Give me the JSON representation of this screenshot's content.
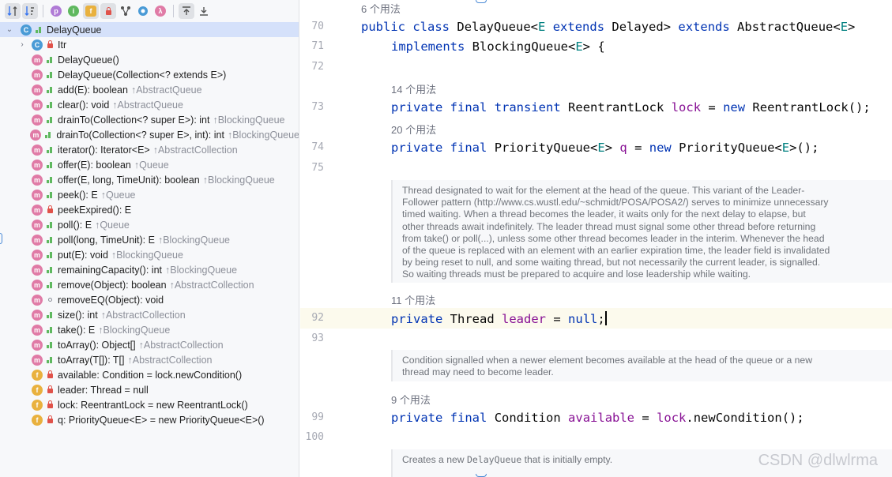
{
  "toolbar": {
    "buttons": [
      {
        "icon": "sort-by-visibility-icon",
        "glyph": "↓⇅"
      },
      {
        "icon": "sort-alphabetically-icon",
        "glyph": "↓a"
      },
      {
        "icon": "show-properties-icon",
        "glyph": "p"
      },
      {
        "icon": "show-inherited-icon",
        "glyph": "i"
      },
      {
        "icon": "show-fields-icon",
        "glyph": "f"
      },
      {
        "icon": "show-non-public-icon",
        "glyph": "🔒"
      },
      {
        "icon": "show-lambdas-icon",
        "glyph": "Y"
      },
      {
        "icon": "show-anonymous-icon",
        "glyph": "◎"
      },
      {
        "icon": "show-lambda-icon",
        "glyph": "λ"
      },
      {
        "icon": "expand-all-icon",
        "glyph": "⤒"
      },
      {
        "icon": "collapse-all-icon",
        "glyph": "⤓"
      }
    ]
  },
  "tree": {
    "root": {
      "kind": "C",
      "name": "DelayQueue"
    },
    "items": [
      {
        "kind": "C",
        "vis": "lock",
        "name": "Itr",
        "inherited": "",
        "expandable": true
      },
      {
        "kind": "m",
        "vis": "pub",
        "name": "DelayQueue()",
        "inherited": ""
      },
      {
        "kind": "m",
        "vis": "pub",
        "name": "DelayQueue(Collection<? extends E>)",
        "inherited": ""
      },
      {
        "kind": "m",
        "vis": "pub",
        "name": "add(E): boolean",
        "inherited": "↑AbstractQueue"
      },
      {
        "kind": "m",
        "vis": "pub",
        "name": "clear(): void",
        "inherited": "↑AbstractQueue"
      },
      {
        "kind": "m",
        "vis": "pub",
        "name": "drainTo(Collection<? super E>): int",
        "inherited": "↑BlockingQueue"
      },
      {
        "kind": "m",
        "vis": "pub",
        "name": "drainTo(Collection<? super E>, int): int",
        "inherited": "↑BlockingQueue"
      },
      {
        "kind": "m",
        "vis": "pub",
        "name": "iterator(): Iterator<E>",
        "inherited": "↑AbstractCollection"
      },
      {
        "kind": "m",
        "vis": "pub",
        "name": "offer(E): boolean",
        "inherited": "↑Queue"
      },
      {
        "kind": "m",
        "vis": "pub",
        "name": "offer(E, long, TimeUnit): boolean",
        "inherited": "↑BlockingQueue"
      },
      {
        "kind": "m",
        "vis": "pub",
        "name": "peek(): E",
        "inherited": "↑Queue"
      },
      {
        "kind": "m",
        "vis": "lock",
        "name": "peekExpired(): E",
        "inherited": ""
      },
      {
        "kind": "m",
        "vis": "pub",
        "name": "poll(): E",
        "inherited": "↑Queue"
      },
      {
        "kind": "m",
        "vis": "pub",
        "name": "poll(long, TimeUnit): E",
        "inherited": "↑BlockingQueue"
      },
      {
        "kind": "m",
        "vis": "pub",
        "name": "put(E): void",
        "inherited": "↑BlockingQueue"
      },
      {
        "kind": "m",
        "vis": "pub",
        "name": "remainingCapacity(): int",
        "inherited": "↑BlockingQueue"
      },
      {
        "kind": "m",
        "vis": "pub",
        "name": "remove(Object): boolean",
        "inherited": "↑AbstractCollection"
      },
      {
        "kind": "m",
        "vis": "pkg",
        "name": "removeEQ(Object): void",
        "inherited": ""
      },
      {
        "kind": "m",
        "vis": "pub",
        "name": "size(): int",
        "inherited": "↑AbstractCollection"
      },
      {
        "kind": "m",
        "vis": "pub",
        "name": "take(): E",
        "inherited": "↑BlockingQueue"
      },
      {
        "kind": "m",
        "vis": "pub",
        "name": "toArray(): Object[]",
        "inherited": "↑AbstractCollection"
      },
      {
        "kind": "m",
        "vis": "pub",
        "name": "toArray(T[]): T[]",
        "inherited": "↑AbstractCollection"
      },
      {
        "kind": "f",
        "vis": "lock",
        "final": true,
        "name": "available: Condition = lock.newCondition()",
        "inherited": ""
      },
      {
        "kind": "f",
        "vis": "lock",
        "final": false,
        "name": "leader: Thread = null",
        "inherited": ""
      },
      {
        "kind": "f",
        "vis": "lock",
        "final": true,
        "name": "lock: ReentrantLock = new ReentrantLock()",
        "inherited": ""
      },
      {
        "kind": "f",
        "vis": "lock",
        "final": true,
        "name": "q: PriorityQueue<E> = new PriorityQueue<E>()",
        "inherited": ""
      }
    ]
  },
  "editor": {
    "usages": {
      "class": "6 个用法",
      "lock": "14 个用法",
      "q": "20 个用法",
      "leader": "11 个用法",
      "available": "9 个用法"
    },
    "line_numbers": {
      "l70": "70",
      "l71": "71",
      "l72": "72",
      "l73": "73",
      "l74": "74",
      "l75": "75",
      "l92": "92",
      "l93": "93",
      "l99": "99",
      "l100": "100"
    },
    "code": {
      "l70": {
        "public": "public",
        "class": "class",
        "name": "DelayQueue<",
        "E1": "E",
        "extends1": "extends",
        "delayed": "Delayed>",
        "extends2": "extends",
        "abs": "AbstractQueue<",
        "E2": "E",
        "close": ">"
      },
      "l71": {
        "implements": "implements",
        "bq": "BlockingQueue<",
        "E": "E",
        "close": "> {"
      },
      "l73": {
        "private": "private",
        "final": "final",
        "transient": "transient",
        "type": "ReentrantLock",
        "field": "lock",
        "eq": "=",
        "new": "new",
        "ctor": "ReentrantLock();"
      },
      "l74": {
        "private": "private",
        "final": "final",
        "type": "PriorityQueue<",
        "E1": "E",
        "type_close": ">",
        "field": "q",
        "eq": "=",
        "new": "new",
        "ctor": "PriorityQueue<",
        "E2": "E",
        "ctor_close": ">();"
      },
      "l92": {
        "private": "private",
        "type": "Thread",
        "field": "leader",
        "eq": "=",
        "null": "null",
        "semi": ";"
      },
      "l99": {
        "private": "private",
        "final": "final",
        "type": "Condition",
        "field": "available",
        "eq": "=",
        "lockref": "lock",
        "call": ".newCondition();"
      }
    },
    "docs": {
      "leader": [
        "Thread designated to wait for the element at the head of the queue. This variant of the Leader-",
        "Follower pattern (http://www.cs.wustl.edu/~schmidt/POSA/POSA2/) serves to minimize unnecessary",
        "timed waiting. When a thread becomes the leader, it waits only for the next delay to elapse, but",
        "other threads await indefinitely. The leader thread must signal some other thread before returning",
        "from take() or poll(...), unless some other thread becomes leader in the interim. Whenever the head",
        "of the queue is replaced with an element with an earlier expiration time, the leader field is invalidated",
        "by being reset to null, and some waiting thread, but not necessarily the current leader, is signalled.",
        "So waiting threads must be prepared to acquire and lose leadership while waiting."
      ],
      "available": [
        "Condition signalled when a newer element becomes available at the head of the queue or a new",
        "thread may need to become leader."
      ],
      "ctor": {
        "before": "Creates a new ",
        "code": "DelayQueue",
        "after": " that is initially empty."
      }
    },
    "watermark": "CSDN @dlwlrma"
  },
  "colors": {
    "keyword": "#0033b3",
    "type_param": "#008080",
    "field": "#871094",
    "method_icon": "#e07ba6",
    "class_icon": "#4a9bd6",
    "field_icon": "#e9b13e",
    "selection": "#d5e1fa",
    "current_line": "#fcfaed"
  }
}
